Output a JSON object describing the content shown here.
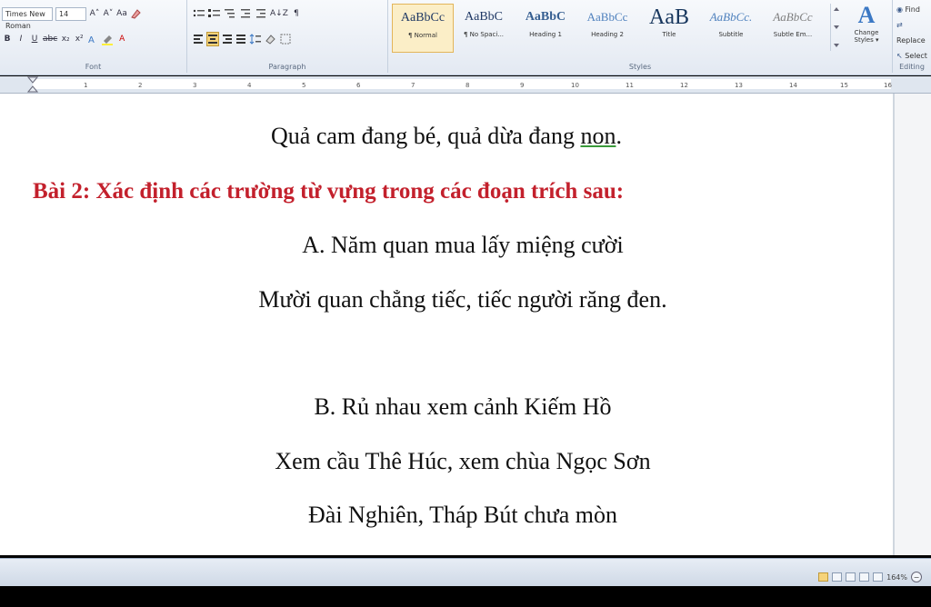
{
  "ribbon": {
    "font_group": {
      "label": "Font",
      "font_name": "Times New Roman",
      "font_size": "14",
      "grow_icon": "A˄",
      "shrink_icon": "A˅",
      "case_icon": "Aa",
      "bold": "B",
      "italic": "I",
      "underline": "U",
      "strike": "abc",
      "subscript": "x₂",
      "superscript": "x²",
      "font_color_glyph": "A"
    },
    "paragraph_group": {
      "label": "Paragraph",
      "sort_glyph": "A↓Z",
      "pilcrow": "¶"
    },
    "styles_group": {
      "label": "Styles",
      "items": [
        {
          "preview": "AaBbCc",
          "name": "¶ Normal"
        },
        {
          "preview": "AaBbC",
          "name": "¶ No Spaci..."
        },
        {
          "preview": "AaBbC",
          "name": "Heading 1"
        },
        {
          "preview": "AaBbCc",
          "name": "Heading 2"
        },
        {
          "preview": "AaB",
          "name": "Title"
        },
        {
          "preview": "AaBbCc.",
          "name": "Subtitle"
        },
        {
          "preview": "AaBbCc",
          "name": "Subtle Em..."
        }
      ],
      "change_styles": "Change Styles ▾",
      "change_styles_glyph": "A"
    },
    "editing_group": {
      "label": "Editing",
      "find": "Find",
      "replace": "Replace",
      "select": "Select"
    }
  },
  "ruler": {
    "ticks": [
      "1",
      "2",
      "3",
      "4",
      "5",
      "6",
      "7",
      "8",
      "9",
      "10",
      "11",
      "12",
      "13",
      "14",
      "15",
      "16"
    ]
  },
  "document": {
    "line1_a": "Quả cam đang bé, quả dừa đang ",
    "line1_b": "non",
    "line1_c": ".",
    "heading": "Bài 2: Xác định các trường từ vựng trong các đoạn trích sau:",
    "a1": "A. Năm quan mua lấy miệng cười",
    "a2": "Mười quan chẳng tiếc, tiếc người răng đen.",
    "b1": "B. Rủ nhau xem cảnh Kiếm Hồ",
    "b2": "Xem cầu Thê Húc, xem chùa Ngọc Sơn",
    "b3": "Đài Nghiên, Tháp Bút chưa mòn"
  },
  "statusbar": {
    "zoom": "164%",
    "zoom_out_glyph": "−"
  },
  "colors": {
    "heading": "#c3202c",
    "ribbon_bg": "#e3e9f2",
    "accent": "#1f3864"
  }
}
